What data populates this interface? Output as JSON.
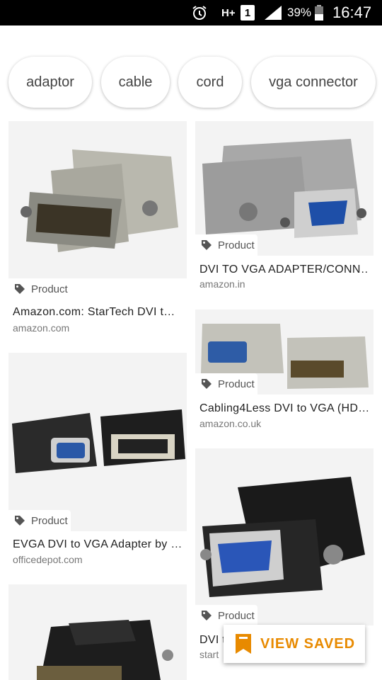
{
  "status_bar": {
    "network": "H+",
    "sim": "1",
    "battery": "39%",
    "time": "16:47"
  },
  "chips": [
    {
      "label": "adaptor"
    },
    {
      "label": "cable"
    },
    {
      "label": "cord"
    },
    {
      "label": "vga connector"
    }
  ],
  "results": [
    {
      "tag": "Product",
      "title": "Amazon.com: StarTech DVI t…",
      "source": "amazon.com"
    },
    {
      "tag": "Product",
      "title": "DVI TO VGA ADAPTER/CONN…",
      "source": "amazon.in"
    },
    {
      "tag": "Product",
      "title": "Cabling4Less DVI to VGA (HD…",
      "source": "amazon.co.uk"
    },
    {
      "tag": "Product",
      "title": "EVGA DVI to VGA Adapter by …",
      "source": "officedepot.com"
    },
    {
      "tag": "Product",
      "title": "DVI t",
      "source": "start"
    }
  ],
  "fab": {
    "label": "VIEW SAVED",
    "icon": "bookmark-icon",
    "color": "#e88a00"
  },
  "colors": {
    "status_bar": "#000000",
    "accent": "#e88a00"
  }
}
